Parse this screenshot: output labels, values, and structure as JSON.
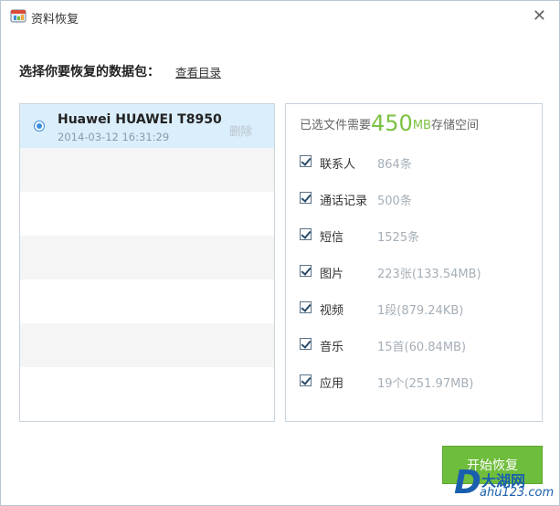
{
  "window": {
    "title": "资料恢复",
    "close_glyph": "✕"
  },
  "prompt": {
    "text": "选择你要恢复的数据包：",
    "link": "查看目录"
  },
  "packages": [
    {
      "name": "Huawei HUAWEI T8950",
      "time": "2014-03-12 16:31:29",
      "delete_label": "删除",
      "selected": true
    }
  ],
  "summary": {
    "prefix": "已选文件需要",
    "size": "450",
    "unit": "MB",
    "suffix": "存储空间"
  },
  "items": [
    {
      "label": "联系人",
      "count": "864条",
      "checked": true
    },
    {
      "label": "通话记录",
      "count": "500条",
      "checked": true
    },
    {
      "label": "短信",
      "count": "1525条",
      "checked": true
    },
    {
      "label": "图片",
      "count": "223张(133.54MB)",
      "checked": true
    },
    {
      "label": "视频",
      "count": "1段(879.24KB)",
      "checked": true
    },
    {
      "label": "音乐",
      "count": "15首(60.84MB)",
      "checked": true
    },
    {
      "label": "应用",
      "count": "19个(251.97MB)",
      "checked": true
    }
  ],
  "start_button": "开始恢复",
  "watermark": {
    "letter": "D",
    "name": "大湖网",
    "url": "ahu123.com"
  },
  "colors": {
    "accent_green": "#7cc243",
    "button_green": "#6fbd3c",
    "selected_row": "#dbeefb",
    "watermark_blue": "#1a5fae"
  }
}
